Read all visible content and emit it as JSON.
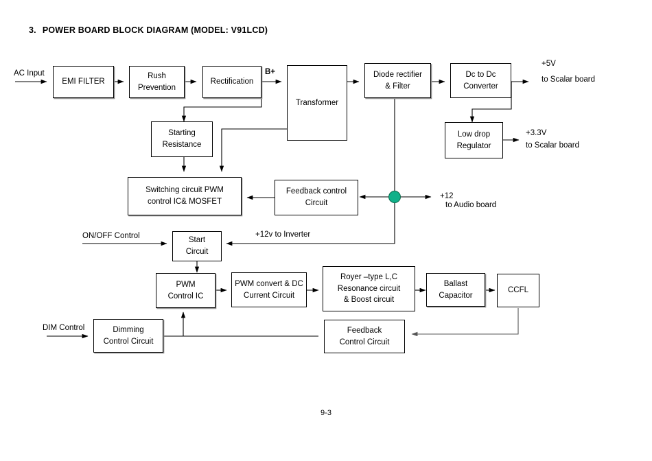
{
  "document": {
    "title_number": "3.",
    "title_text": "POWER BOARD BLOCK DIAGRAM (MODEL: V91LCD)",
    "page_number": "9-3"
  },
  "colors": {
    "node_fill": "#10b089",
    "node_stroke": "#0d6b4d",
    "wire": "#000000",
    "block_border": "#000000",
    "block_shadow": "#8c8c8c",
    "background": "#ffffff"
  },
  "blocks": {
    "emi_filter": {
      "line1": "EMI FILTER"
    },
    "rush_prevention": {
      "line1": "Rush",
      "line2": "Prevention"
    },
    "rectification": {
      "line1": "Rectification"
    },
    "transformer": {
      "line1": "Transformer"
    },
    "diode_rectifier": {
      "line1": "Diode rectifier",
      "line2": "& Filter"
    },
    "dc_to_dc": {
      "line1": "Dc to Dc",
      "line2": "Converter"
    },
    "low_drop_regulator": {
      "line1": "Low drop",
      "line2": "Regulator"
    },
    "starting_resistance": {
      "line1": "Starting",
      "line2": "Resistance"
    },
    "switching_circuit": {
      "line1": "Switching circuit PWM",
      "line2": "control IC& MOSFET"
    },
    "feedback_control": {
      "line1": "Feedback control",
      "line2": "Circuit"
    },
    "start_circuit": {
      "line1": "Start",
      "line2": "Circuit"
    },
    "pwm_control_ic": {
      "line1": "PWM",
      "line2": "Control IC"
    },
    "pwm_convert": {
      "line1": "PWM convert & DC",
      "line2": "Current Circuit"
    },
    "royer_resonance": {
      "line1": "Royer –type L,C",
      "line2": "Resonance circuit",
      "line3": "& Boost circuit"
    },
    "ballast_capacitor": {
      "line1": "Ballast",
      "line2": "Capacitor"
    },
    "ccfl": {
      "line1": "CCFL"
    },
    "dimming_control": {
      "line1": "Dimming",
      "line2": "Control Circuit"
    },
    "feedback_control_lower": {
      "line1": "Feedback",
      "line2": "Control Circuit"
    }
  },
  "labels": {
    "ac_input": "AC Input",
    "b_plus": "B+",
    "out_5v": "+5V",
    "out_5v_dest": "to Scalar board",
    "out_33v": "+3.3V",
    "out_33v_dest": "to Scalar board",
    "out_12": "+12",
    "out_12_dest": "to Audio board",
    "on_off_control": "ON/OFF Control",
    "inverter_12v": "+12v to Inverter",
    "dim_control": "DIM Control"
  }
}
